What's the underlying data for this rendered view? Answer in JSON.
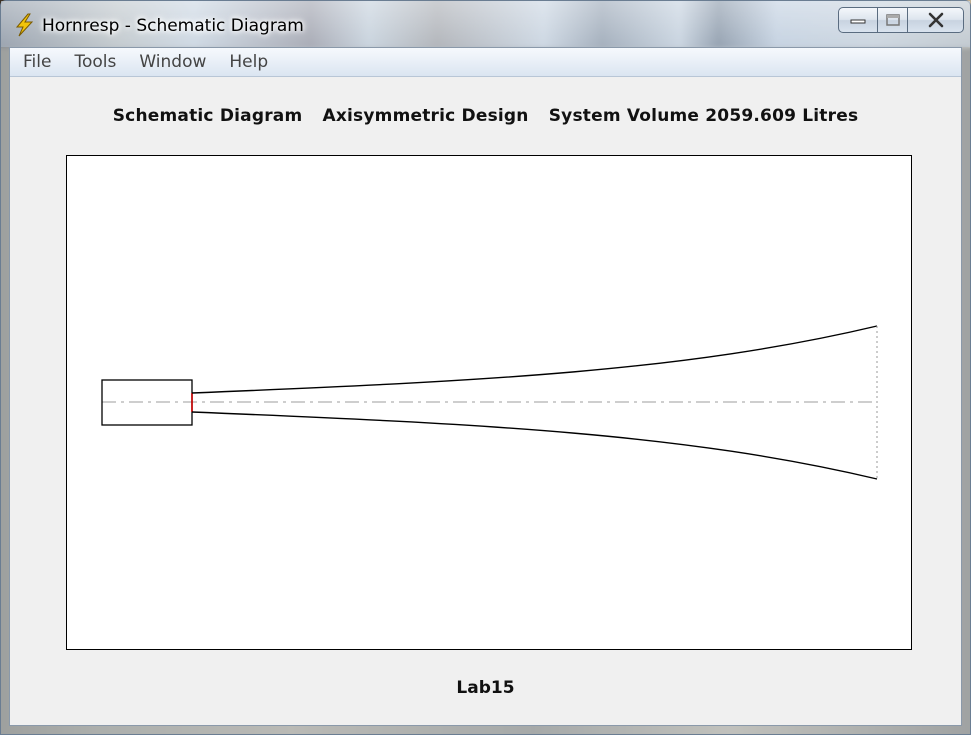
{
  "window": {
    "title": "Hornresp - Schematic Diagram",
    "icon": "lightning-icon",
    "controls": {
      "minimize_icon": "minimize-icon",
      "maximize_icon": "maximize-icon",
      "close_icon": "close-icon",
      "minimize_glyph": "—",
      "maximize_glyph": "☐",
      "close_glyph": "✕"
    }
  },
  "menu": {
    "items": [
      "File",
      "Tools",
      "Window",
      "Help"
    ]
  },
  "heading": {
    "part1": "Schematic Diagram",
    "part2": "Axisymmetric Design",
    "part3": "System Volume 2059.609 Litres"
  },
  "diagram": {
    "driver_line_color": "#cc0000",
    "outline_color": "#000000",
    "axis_color": "#b0b0b0"
  },
  "footer": {
    "label": "Lab15"
  }
}
